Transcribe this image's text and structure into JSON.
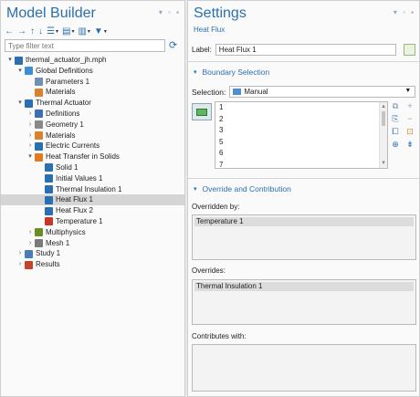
{
  "left": {
    "title": "Model Builder",
    "window_controls": "▾ ▫ ▪",
    "filter_placeholder": "Type filter text",
    "toolbar": [
      "←",
      "→",
      "↑",
      "↓",
      "☰",
      "▤",
      "▥",
      "▦",
      "▼"
    ],
    "tree": [
      {
        "label": "thermal_actuator_jh.mph",
        "icon": "root-file-icon"
      },
      {
        "label": "Global Definitions",
        "icon": "globe-icon"
      },
      {
        "label": "Parameters 1",
        "icon": "parameters-icon"
      },
      {
        "label": "Materials",
        "icon": "materials-icon"
      },
      {
        "label": "Thermal Actuator",
        "icon": "component-icon"
      },
      {
        "label": "Definitions",
        "icon": "definitions-icon"
      },
      {
        "label": "Geometry 1",
        "icon": "geometry-icon"
      },
      {
        "label": "Materials",
        "icon": "materials-icon"
      },
      {
        "label": "Electric Currents",
        "icon": "electric-currents-icon"
      },
      {
        "label": "Heat Transfer in Solids",
        "icon": "heat-transfer-icon"
      },
      {
        "label": "Solid 1",
        "icon": "solid-icon"
      },
      {
        "label": "Initial Values 1",
        "icon": "initial-values-icon"
      },
      {
        "label": "Thermal Insulation 1",
        "icon": "thermal-insulation-icon"
      },
      {
        "label": "Heat Flux 1",
        "icon": "heat-flux-icon"
      },
      {
        "label": "Heat Flux 2",
        "icon": "heat-flux-icon"
      },
      {
        "label": "Temperature 1",
        "icon": "temperature-icon"
      },
      {
        "label": "Multiphysics",
        "icon": "multiphysics-icon"
      },
      {
        "label": "Mesh 1",
        "icon": "mesh-icon"
      },
      {
        "label": "Study 1",
        "icon": "study-icon"
      },
      {
        "label": "Results",
        "icon": "results-icon"
      }
    ]
  },
  "right": {
    "title": "Settings",
    "subtitle": "Heat Flux",
    "window_controls": "▾ ▫ ▪",
    "label_key": "Label:",
    "label_value": "Heat Flux 1",
    "boundary_section": "Boundary Selection",
    "selection_key": "Selection:",
    "selection_value": "Manual",
    "boundaries": [
      "1",
      "2",
      "3",
      "5",
      "6",
      "7"
    ],
    "override_section": "Override and Contribution",
    "overridden_by_label": "Overridden by:",
    "overridden_by": [
      "Temperature 1"
    ],
    "overrides_label": "Overrides:",
    "overrides": [
      "Thermal Insulation 1"
    ],
    "contributes_label": "Contributes with:"
  },
  "colors": {
    "accent": "#2a6fb0",
    "selection_bg": "#d5d5d5"
  }
}
